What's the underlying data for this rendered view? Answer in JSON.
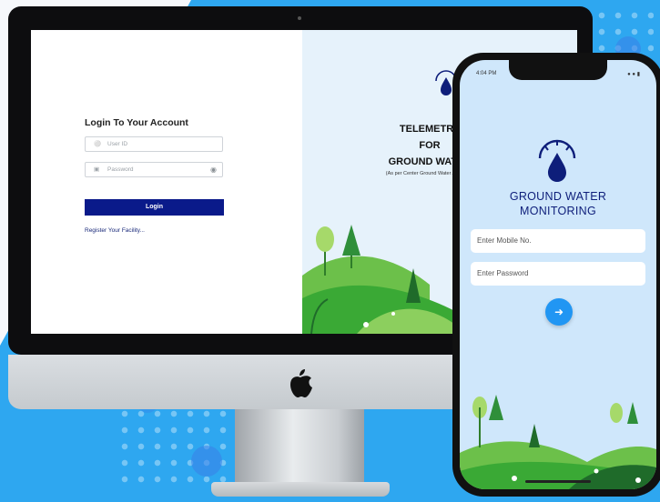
{
  "desktop": {
    "login_title": "Login To Your Account",
    "userid_placeholder": "User ID",
    "password_placeholder": "Password",
    "login_button": "Login",
    "register_link": "Register Your Facility...",
    "hero_line1": "TELEMETRY",
    "hero_line2": "FOR",
    "hero_line3": "GROUND WATER",
    "hero_sub": "(As per Center Ground Water Authority)"
  },
  "phone": {
    "status_time": "4:04 PM",
    "app_title_line1": "GROUND WATER",
    "app_title_line2": "MONITORING",
    "mobile_placeholder": "Enter Mobile No.",
    "password_placeholder": "Enter Password"
  },
  "colors": {
    "primary_navy": "#0a1a8a",
    "accent_blue": "#2196f3",
    "background_blue": "#2ea7f0",
    "grass_green": "#3aa935"
  },
  "icons": [
    "user-icon",
    "lock-icon",
    "eye-icon",
    "gauge-drop-icon",
    "login-arrow-icon",
    "apple-logo-icon"
  ]
}
